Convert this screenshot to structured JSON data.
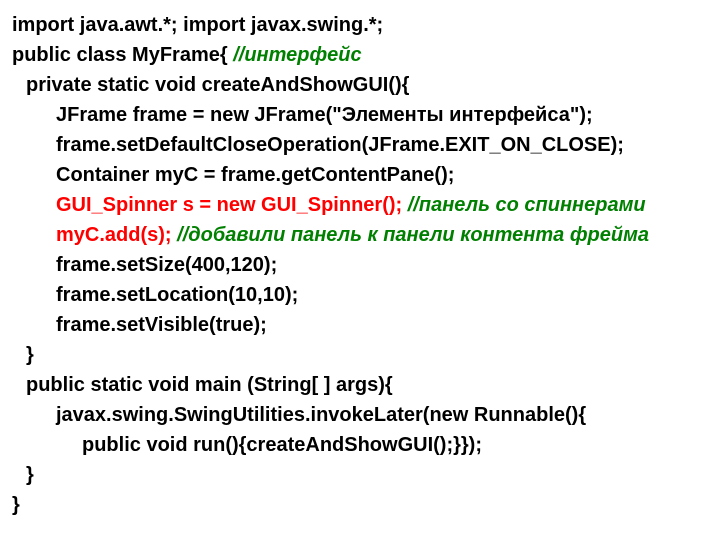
{
  "lines": [
    {
      "indent": 0,
      "segments": [
        {
          "text": "import java.awt.*; import javax.swing.*;",
          "cls": ""
        }
      ]
    },
    {
      "indent": 0,
      "segments": [
        {
          "text": "public class MyFrame{ ",
          "cls": ""
        },
        {
          "text": "//интерфейс",
          "cls": "c-green"
        }
      ]
    },
    {
      "indent": 1,
      "segments": [
        {
          "text": "private static void createAndShowGUI(){",
          "cls": ""
        }
      ]
    },
    {
      "indent": 2,
      "segments": [
        {
          "text": "JFrame frame = new JFrame(\"Элементы интерфейса\");",
          "cls": ""
        }
      ]
    },
    {
      "indent": 2,
      "segments": [
        {
          "text": "frame.setDefaultCloseOperation(JFrame.EXIT_ON_CLOSE);",
          "cls": ""
        }
      ]
    },
    {
      "indent": 2,
      "segments": [
        {
          "text": "Container myC = frame.getContentPane();",
          "cls": ""
        }
      ]
    },
    {
      "indent": 2,
      "segments": [
        {
          "text": "GUI_Spinner s = new GUI_Spinner();",
          "cls": "c-red"
        },
        {
          "text": " ",
          "cls": ""
        },
        {
          "text": "//панель со спиннерами",
          "cls": "c-green"
        }
      ]
    },
    {
      "indent": 2,
      "segments": [
        {
          "text": "myC.add(s);",
          "cls": "c-red"
        },
        {
          "text": " ",
          "cls": ""
        },
        {
          "text": "//добавили панель к панели контента фрейма",
          "cls": "c-green"
        }
      ]
    },
    {
      "indent": 2,
      "segments": [
        {
          "text": "frame.setSize(400,120);",
          "cls": ""
        }
      ]
    },
    {
      "indent": 2,
      "segments": [
        {
          "text": "frame.setLocation(10,10);",
          "cls": ""
        }
      ]
    },
    {
      "indent": 2,
      "segments": [
        {
          "text": "frame.setVisible(true);",
          "cls": ""
        }
      ]
    },
    {
      "indent": 1,
      "segments": [
        {
          "text": "}",
          "cls": ""
        }
      ]
    },
    {
      "indent": 1,
      "segments": [
        {
          "text": "public static void main (String[ ] args){",
          "cls": ""
        }
      ]
    },
    {
      "indent": 2,
      "segments": [
        {
          "text": "javax.swing.SwingUtilities.invokeLater(new Runnable(){",
          "cls": ""
        }
      ]
    },
    {
      "indent": 3,
      "segments": [
        {
          "text": "public void run(){createAndShowGUI();}});",
          "cls": ""
        }
      ]
    },
    {
      "indent": 1,
      "segments": [
        {
          "text": "}",
          "cls": ""
        }
      ]
    },
    {
      "indent": 0,
      "segments": [
        {
          "text": "}",
          "cls": ""
        }
      ]
    }
  ]
}
